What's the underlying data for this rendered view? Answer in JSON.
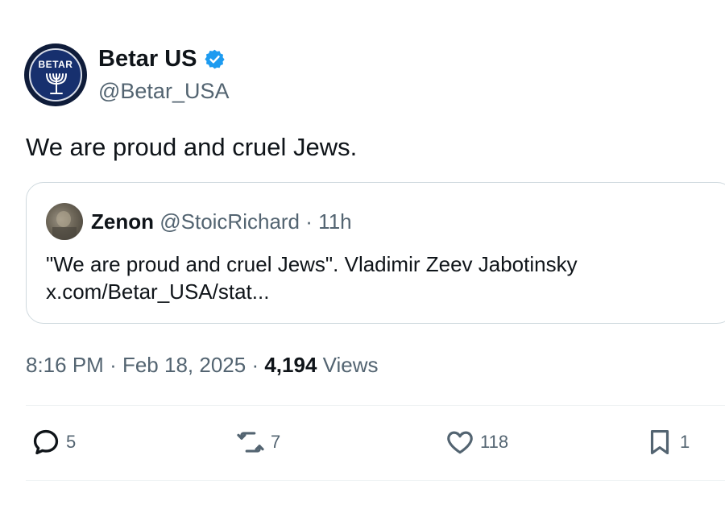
{
  "author": {
    "display_name": "Betar US",
    "handle": "@Betar_USA",
    "avatar_text": "BETAR",
    "verified_icon": "verified-badge-icon",
    "verified_color": "#1d9bf0"
  },
  "tweet": {
    "text": "We are proud and cruel Jews."
  },
  "quote": {
    "display_name": "Zenon",
    "handle": "@StoicRichard",
    "separator": "·",
    "time": "11h",
    "text": "\"We are proud and cruel Jews\". Vladimir Zeev Jabotinsky",
    "link": "x.com/Betar_USA/stat..."
  },
  "meta": {
    "time": "8:16 PM",
    "sep1": "·",
    "date": "Feb 18, 2025",
    "sep2": "·",
    "views_count": "4,194",
    "views_label": "Views"
  },
  "actions": {
    "replies": "5",
    "reposts": "7",
    "likes": "118",
    "bookmarks": "1"
  },
  "colors": {
    "text_primary": "#0f1419",
    "text_secondary": "#536471",
    "border": "#cfd9de"
  }
}
